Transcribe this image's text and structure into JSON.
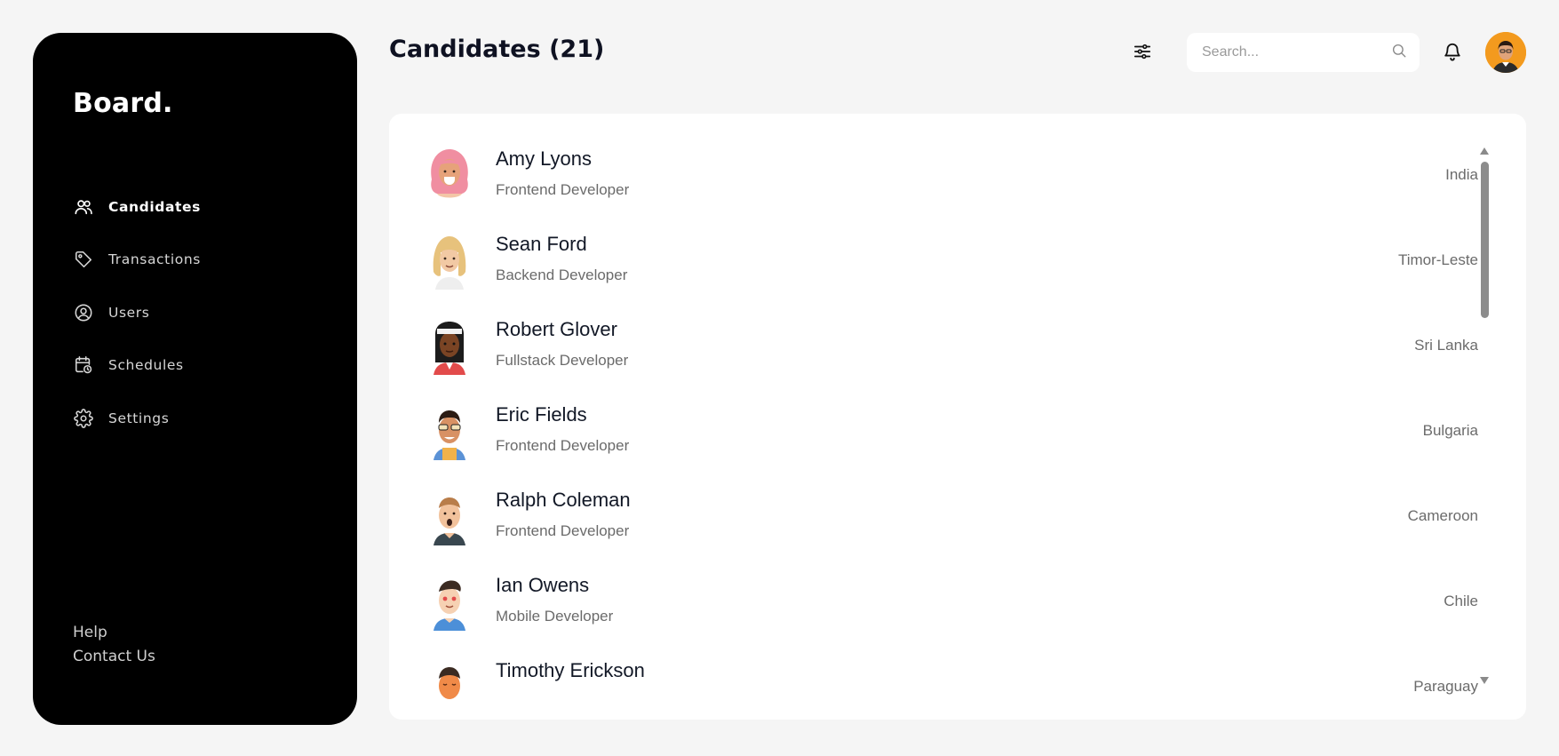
{
  "brand": "Board.",
  "nav": [
    {
      "label": "Candidates",
      "icon": "users-icon",
      "active": true
    },
    {
      "label": "Transactions",
      "icon": "tag-icon",
      "active": false
    },
    {
      "label": "Users",
      "icon": "user-circle-icon",
      "active": false
    },
    {
      "label": "Schedules",
      "icon": "calendar-clock-icon",
      "active": false
    },
    {
      "label": "Settings",
      "icon": "gear-icon",
      "active": false
    }
  ],
  "footer": {
    "help": "Help",
    "contact": "Contact Us"
  },
  "header": {
    "title": "Candidates (21)",
    "search_placeholder": "Search..."
  },
  "candidates": [
    {
      "name": "Amy Lyons",
      "role": "Frontend Developer",
      "country": "India"
    },
    {
      "name": "Sean Ford",
      "role": "Backend Developer",
      "country": "Timor-Leste"
    },
    {
      "name": "Robert Glover",
      "role": "Fullstack Developer",
      "country": "Sri Lanka"
    },
    {
      "name": "Eric Fields",
      "role": "Frontend Developer",
      "country": "Bulgaria"
    },
    {
      "name": "Ralph Coleman",
      "role": "Frontend Developer",
      "country": "Cameroon"
    },
    {
      "name": "Ian Owens",
      "role": "Mobile Developer",
      "country": "Chile"
    },
    {
      "name": "Timothy Erickson",
      "role": "",
      "country": "Paraguay"
    }
  ],
  "colors": {
    "background": "#f5f5f5",
    "sidebar": "#000000",
    "panel": "#ffffff",
    "avatar_accent": "#f39a1e"
  }
}
